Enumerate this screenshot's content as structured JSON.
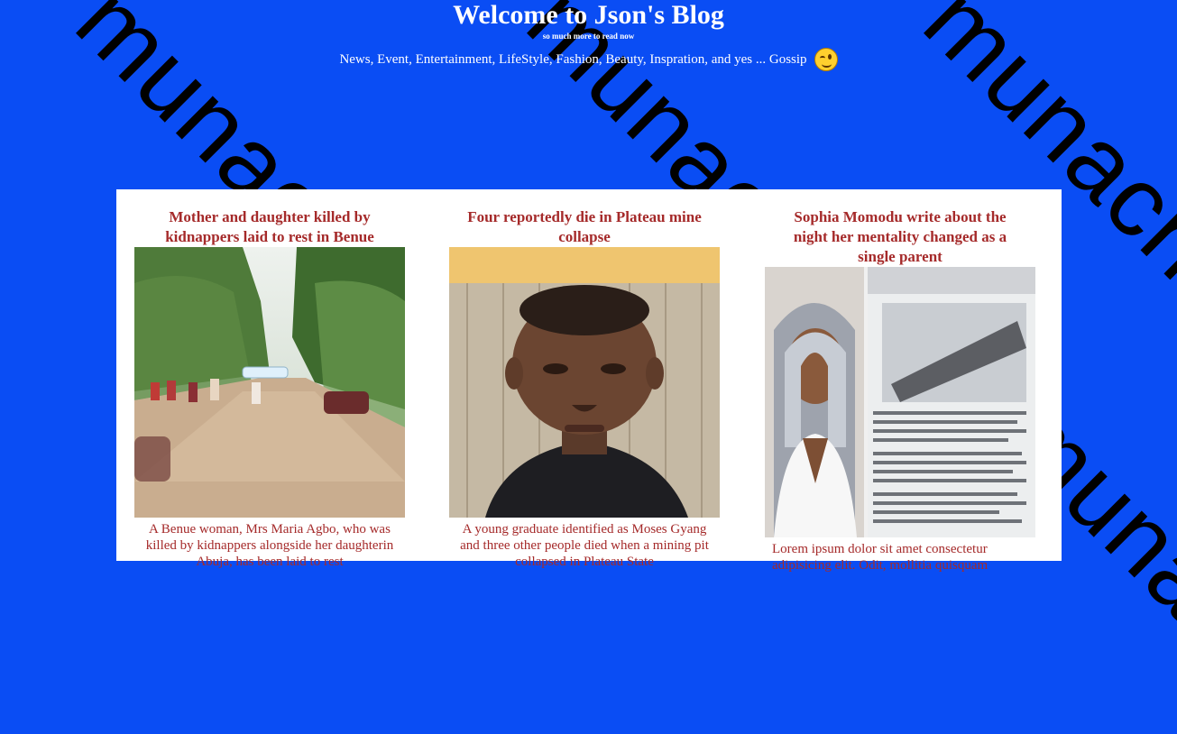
{
  "watermark": {
    "text": "munachi"
  },
  "header": {
    "site_title": "Welcome to Json's Blog",
    "tagline": "so much more to read now",
    "categories": "News, Event, Entertainment, LifeStyle, Fashion, Beauty, Inspration, and yes ... Gossip",
    "emoji_icon": "winking-face-icon"
  },
  "posts": [
    {
      "title": "Mother and daughter killed by kidnappers laid to rest in Benue",
      "image": "rural-road-coffin-procession",
      "excerpt": "A Benue woman, Mrs Maria Agbo, who was killed by kidnappers alongside her daughterin Abuja, has been laid to rest"
    },
    {
      "title": "Four reportedly die in Plateau mine collapse",
      "image": "young-man-selfie",
      "excerpt": "A young graduate identified as Moses Gyang and three other people died when a mining pit collapsed in Plateau State"
    },
    {
      "title": "Sophia Momodu write about the night her mentality changed as a single parent",
      "image": "woman-portrait-and-testimony",
      "excerpt": "Lorem ipsum dolor sit amet consectetur adipisicing elit. Odit, mollitia quisquam"
    }
  ],
  "colors": {
    "background": "#0a4df4",
    "title_text": "#a52a2a",
    "card": "#ffffff"
  }
}
